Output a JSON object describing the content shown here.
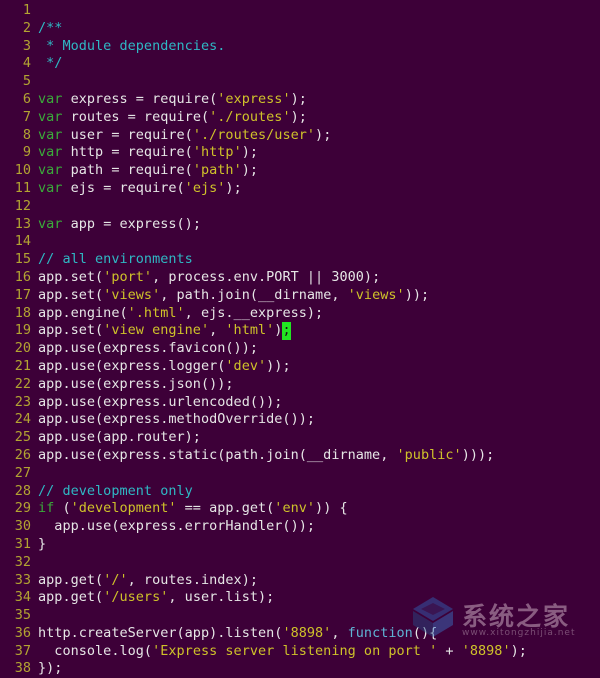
{
  "editor": {
    "theme_background": "#3d0038",
    "line_number_color": "#b3a432",
    "cursor_color": "#22e522",
    "cursor_line": 19,
    "cursor_char": ";",
    "first_line": 1,
    "last_line": 38,
    "language": "javascript",
    "lines": [
      {
        "n": "1",
        "tokens": []
      },
      {
        "n": "2",
        "tokens": [
          {
            "c": "com",
            "t": "/**"
          }
        ]
      },
      {
        "n": "3",
        "tokens": [
          {
            "c": "com",
            "t": " * Module dependencies."
          }
        ]
      },
      {
        "n": "4",
        "tokens": [
          {
            "c": "com",
            "t": " */"
          }
        ]
      },
      {
        "n": "5",
        "tokens": []
      },
      {
        "n": "6",
        "tokens": [
          {
            "c": "kw",
            "t": "var"
          },
          {
            "c": "plain",
            "t": " express = require("
          },
          {
            "c": "str",
            "t": "'express'"
          },
          {
            "c": "plain",
            "t": ");"
          }
        ]
      },
      {
        "n": "7",
        "tokens": [
          {
            "c": "kw",
            "t": "var"
          },
          {
            "c": "plain",
            "t": " routes = require("
          },
          {
            "c": "str",
            "t": "'./routes'"
          },
          {
            "c": "plain",
            "t": ");"
          }
        ]
      },
      {
        "n": "8",
        "tokens": [
          {
            "c": "kw",
            "t": "var"
          },
          {
            "c": "plain",
            "t": " user = require("
          },
          {
            "c": "str",
            "t": "'./routes/user'"
          },
          {
            "c": "plain",
            "t": ");"
          }
        ]
      },
      {
        "n": "9",
        "tokens": [
          {
            "c": "kw",
            "t": "var"
          },
          {
            "c": "plain",
            "t": " http = require("
          },
          {
            "c": "str",
            "t": "'http'"
          },
          {
            "c": "plain",
            "t": ");"
          }
        ]
      },
      {
        "n": "10",
        "tokens": [
          {
            "c": "kw",
            "t": "var"
          },
          {
            "c": "plain",
            "t": " path = require("
          },
          {
            "c": "str",
            "t": "'path'"
          },
          {
            "c": "plain",
            "t": ");"
          }
        ]
      },
      {
        "n": "11",
        "tokens": [
          {
            "c": "kw",
            "t": "var"
          },
          {
            "c": "plain",
            "t": " ejs = require("
          },
          {
            "c": "str",
            "t": "'ejs'"
          },
          {
            "c": "plain",
            "t": ");"
          }
        ]
      },
      {
        "n": "12",
        "tokens": []
      },
      {
        "n": "13",
        "tokens": [
          {
            "c": "kw",
            "t": "var"
          },
          {
            "c": "plain",
            "t": " app = express();"
          }
        ]
      },
      {
        "n": "14",
        "tokens": []
      },
      {
        "n": "15",
        "tokens": [
          {
            "c": "com",
            "t": "// all environments"
          }
        ]
      },
      {
        "n": "16",
        "tokens": [
          {
            "c": "plain",
            "t": "app.set("
          },
          {
            "c": "str",
            "t": "'port'"
          },
          {
            "c": "plain",
            "t": ", process.env.PORT || 3000);"
          }
        ]
      },
      {
        "n": "17",
        "tokens": [
          {
            "c": "plain",
            "t": "app.set("
          },
          {
            "c": "str",
            "t": "'views'"
          },
          {
            "c": "plain",
            "t": ", path.join(__dirname, "
          },
          {
            "c": "str",
            "t": "'views'"
          },
          {
            "c": "plain",
            "t": "));"
          }
        ]
      },
      {
        "n": "18",
        "tokens": [
          {
            "c": "plain",
            "t": "app.engine("
          },
          {
            "c": "str",
            "t": "'.html'"
          },
          {
            "c": "plain",
            "t": ", ejs.__express);"
          }
        ]
      },
      {
        "n": "19",
        "tokens": [
          {
            "c": "plain",
            "t": "app.set("
          },
          {
            "c": "str",
            "t": "'view engine'"
          },
          {
            "c": "plain",
            "t": ", "
          },
          {
            "c": "str",
            "t": "'html'"
          },
          {
            "c": "plain",
            "t": ")"
          },
          {
            "c": "cursor",
            "t": ";"
          }
        ]
      },
      {
        "n": "20",
        "tokens": [
          {
            "c": "plain",
            "t": "app.use(express.favicon());"
          }
        ]
      },
      {
        "n": "21",
        "tokens": [
          {
            "c": "plain",
            "t": "app.use(express.logger("
          },
          {
            "c": "str",
            "t": "'dev'"
          },
          {
            "c": "plain",
            "t": "));"
          }
        ]
      },
      {
        "n": "22",
        "tokens": [
          {
            "c": "plain",
            "t": "app.use(express.json());"
          }
        ]
      },
      {
        "n": "23",
        "tokens": [
          {
            "c": "plain",
            "t": "app.use(express.urlencoded());"
          }
        ]
      },
      {
        "n": "24",
        "tokens": [
          {
            "c": "plain",
            "t": "app.use(express.methodOverride());"
          }
        ]
      },
      {
        "n": "25",
        "tokens": [
          {
            "c": "plain",
            "t": "app.use(app.router);"
          }
        ]
      },
      {
        "n": "26",
        "tokens": [
          {
            "c": "plain",
            "t": "app.use(express.static(path.join(__dirname, "
          },
          {
            "c": "str",
            "t": "'public'"
          },
          {
            "c": "plain",
            "t": ")));"
          }
        ]
      },
      {
        "n": "27",
        "tokens": []
      },
      {
        "n": "28",
        "tokens": [
          {
            "c": "com",
            "t": "// development only"
          }
        ]
      },
      {
        "n": "29",
        "tokens": [
          {
            "c": "kw",
            "t": "if"
          },
          {
            "c": "plain",
            "t": " ("
          },
          {
            "c": "str",
            "t": "'development'"
          },
          {
            "c": "plain",
            "t": " == app.get("
          },
          {
            "c": "str",
            "t": "'env'"
          },
          {
            "c": "plain",
            "t": ")) {"
          }
        ]
      },
      {
        "n": "30",
        "tokens": [
          {
            "c": "plain",
            "t": "  app.use(express.errorHandler());"
          }
        ]
      },
      {
        "n": "31",
        "tokens": [
          {
            "c": "plain",
            "t": "}"
          }
        ]
      },
      {
        "n": "32",
        "tokens": []
      },
      {
        "n": "33",
        "tokens": [
          {
            "c": "plain",
            "t": "app.get("
          },
          {
            "c": "str",
            "t": "'/'"
          },
          {
            "c": "plain",
            "t": ", routes.index);"
          }
        ]
      },
      {
        "n": "34",
        "tokens": [
          {
            "c": "plain",
            "t": "app.get("
          },
          {
            "c": "str",
            "t": "'/users'"
          },
          {
            "c": "plain",
            "t": ", user.list);"
          }
        ]
      },
      {
        "n": "35",
        "tokens": []
      },
      {
        "n": "36",
        "tokens": [
          {
            "c": "plain",
            "t": "http.createServer(app).listen("
          },
          {
            "c": "str",
            "t": "'8898'"
          },
          {
            "c": "plain",
            "t": ", "
          },
          {
            "c": "blue",
            "t": "function"
          },
          {
            "c": "plain",
            "t": "(){"
          }
        ]
      },
      {
        "n": "37",
        "tokens": [
          {
            "c": "plain",
            "t": "  console.log("
          },
          {
            "c": "str",
            "t": "'Express server listening on port '"
          },
          {
            "c": "plain",
            "t": " + "
          },
          {
            "c": "str",
            "t": "'8898'"
          },
          {
            "c": "plain",
            "t": ");"
          }
        ]
      },
      {
        "n": "38",
        "tokens": [
          {
            "c": "plain",
            "t": "});"
          }
        ]
      }
    ]
  },
  "watermark": {
    "text": "系统之家",
    "sub": "www.xitongzhijia.net",
    "logo_color": "#2f6fc4"
  }
}
